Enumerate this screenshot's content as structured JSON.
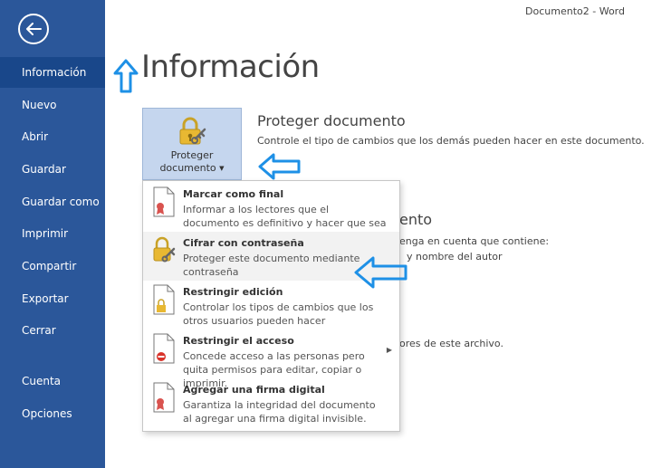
{
  "window": {
    "title": "Documento2 - Word"
  },
  "sidebar": {
    "items": [
      {
        "label": "Información"
      },
      {
        "label": "Nuevo"
      },
      {
        "label": "Abrir"
      },
      {
        "label": "Guardar"
      },
      {
        "label": "Guardar como"
      },
      {
        "label": "Imprimir"
      },
      {
        "label": "Compartir"
      },
      {
        "label": "Exportar"
      },
      {
        "label": "Cerrar"
      },
      {
        "label": "Cuenta"
      },
      {
        "label": "Opciones"
      }
    ],
    "active_index": 0
  },
  "main": {
    "title": "Información",
    "protect": {
      "button_label_line1": "Proteger",
      "button_label_line2": "documento",
      "heading": "Proteger documento",
      "description": "Controle el tipo de cambios que los demás pueden hacer en este documento."
    },
    "background_fragments": {
      "heading_fragment": "ento",
      "line1": "enga en cuenta que contiene:",
      "line2": "y nombre del autor",
      "line3": "ores de este archivo."
    }
  },
  "menu": {
    "items": [
      {
        "title": "Marcar como final",
        "description": "Informar a los lectores que el documento es definitivo y hacer que sea de solo lectura."
      },
      {
        "title": "Cifrar con contraseña",
        "description": "Proteger este documento mediante contraseña"
      },
      {
        "title": "Restringir edición",
        "description": "Controlar los tipos de cambios que los otros usuarios pueden hacer"
      },
      {
        "title": "Restringir el acceso",
        "description": "Concede acceso a las personas pero quita permisos para editar, copiar o imprimir."
      },
      {
        "title": "Agregar una firma digital",
        "description": "Garantiza la integridad del documento al agregar una firma digital invisible."
      }
    ]
  },
  "colors": {
    "sidebar_bg": "#2b579a",
    "sidebar_active": "#19478a",
    "annotation_arrow": "#1e90e6",
    "button_bg": "#c5d6ee"
  }
}
